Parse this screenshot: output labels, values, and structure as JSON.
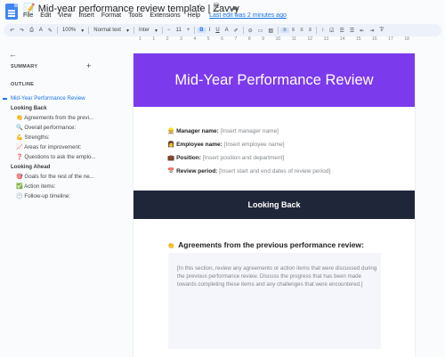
{
  "window": {
    "title": "📝 Mid-year performance review template | Zavvy",
    "title_icons": "☆ ⎘ ☁"
  },
  "menu": {
    "items": [
      "File",
      "Edit",
      "View",
      "Insert",
      "Format",
      "Tools",
      "Extensions",
      "Help"
    ],
    "last_edit": "Last edit was 2 minutes ago"
  },
  "toolbar": {
    "zoom": "100%",
    "style": "Normal text",
    "font": "Inter",
    "font_size": "11",
    "bold": "B"
  },
  "ruler": {
    "ticks": [
      "1",
      "1",
      "2",
      "3",
      "4",
      "5",
      "6",
      "7",
      "8",
      "9",
      "10",
      "11",
      "12",
      "13",
      "14",
      "15",
      "16",
      "17",
      "18"
    ]
  },
  "sidebar": {
    "summary_label": "SUMMARY",
    "add_icon": "+",
    "outline_label": "OUTLINE",
    "outline": [
      {
        "level": "h1",
        "text": "Mid-Year Performance Review",
        "active": true
      },
      {
        "level": "h2",
        "text": "Looking Back"
      },
      {
        "level": "h3",
        "text": "👏 Agreements from the previ..."
      },
      {
        "level": "h3",
        "text": "🔍 Overall performance:"
      },
      {
        "level": "h3",
        "text": "💪 Strengths:"
      },
      {
        "level": "h3",
        "text": "📈 Areas for improvement:"
      },
      {
        "level": "h3",
        "text": "❓ Questions to ask the emplo..."
      },
      {
        "level": "h2",
        "text": "Looking Ahead"
      },
      {
        "level": "h3",
        "text": "🎯 Goals for the rest of the ne..."
      },
      {
        "level": "h3",
        "text": "✅ Action items:"
      },
      {
        "level": "h3",
        "text": "🕐 Follow-up timeline:"
      }
    ]
  },
  "document": {
    "title": "Mid-Year Performance Review",
    "hero_color": "#7c3aed",
    "fields": [
      {
        "emoji": "👷",
        "label": "Manager name:",
        "placeholder": "[Insert manager name]"
      },
      {
        "emoji": "👩",
        "label": "Employee name:",
        "placeholder": "[Insert employee name]"
      },
      {
        "emoji": "💼",
        "label": "Position:",
        "placeholder": "[Insert position and department]"
      },
      {
        "emoji": "📅",
        "label": "Review period:",
        "placeholder": "[Insert start and end dates of review period]"
      }
    ],
    "section_title": "Looking Back",
    "section_color": "#202639",
    "subheading_emoji": "👏",
    "subheading": "Agreements from the previous performance review:",
    "note": "[In this section, review any agreements or action items that were discussed during the previous performance review. Discuss the progress that has been made towards completing these items and any challenges that were encountered.]"
  }
}
